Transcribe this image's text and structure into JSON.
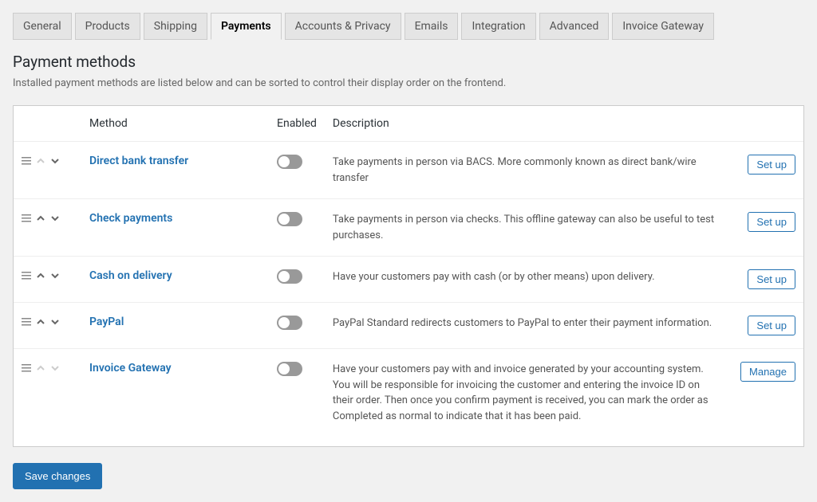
{
  "tabs": [
    {
      "label": "General",
      "active": false
    },
    {
      "label": "Products",
      "active": false
    },
    {
      "label": "Shipping",
      "active": false
    },
    {
      "label": "Payments",
      "active": true
    },
    {
      "label": "Accounts & Privacy",
      "active": false
    },
    {
      "label": "Emails",
      "active": false
    },
    {
      "label": "Integration",
      "active": false
    },
    {
      "label": "Advanced",
      "active": false
    },
    {
      "label": "Invoice Gateway",
      "active": false
    }
  ],
  "page": {
    "title": "Payment methods",
    "help": "Installed payment methods are listed below and can be sorted to control their display order on the frontend."
  },
  "columns": {
    "method": "Method",
    "enabled": "Enabled",
    "description": "Description"
  },
  "methods": [
    {
      "name": "Direct bank transfer",
      "desc": "Take payments in person via BACS. More commonly known as direct bank/wire transfer",
      "action": "Set up",
      "up_disabled": true,
      "down_disabled": false
    },
    {
      "name": "Check payments",
      "desc": "Take payments in person via checks. This offline gateway can also be useful to test purchases.",
      "action": "Set up",
      "up_disabled": false,
      "down_disabled": false
    },
    {
      "name": "Cash on delivery",
      "desc": "Have your customers pay with cash (or by other means) upon delivery.",
      "action": "Set up",
      "up_disabled": false,
      "down_disabled": false
    },
    {
      "name": "PayPal",
      "desc": "PayPal Standard redirects customers to PayPal to enter their payment information.",
      "action": "Set up",
      "up_disabled": false,
      "down_disabled": false
    },
    {
      "name": "Invoice Gateway",
      "desc": "Have your customers pay with and invoice generated by your accounting system. You will be responsible for invoicing the customer and entering the invoice ID on their order. Then once you confirm payment is received, you can mark the order as Completed as normal to indicate that it has been paid.",
      "action": "Manage",
      "up_disabled": true,
      "down_disabled": true
    }
  ],
  "save_label": "Save changes"
}
